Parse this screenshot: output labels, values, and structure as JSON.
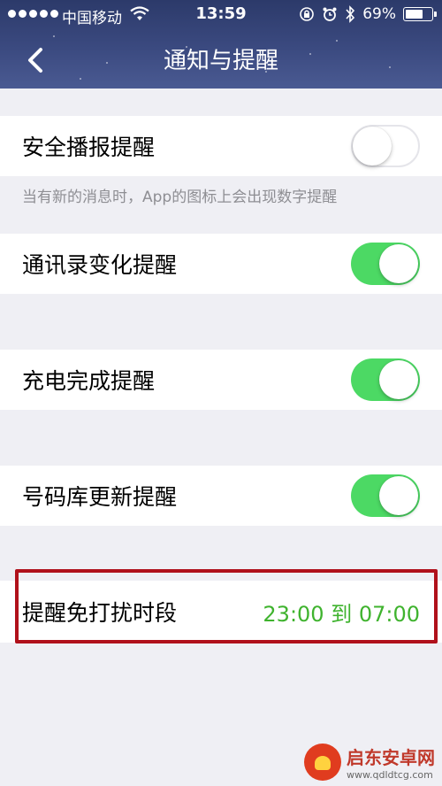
{
  "status_bar": {
    "carrier": "中国移动",
    "time": "13:59",
    "battery_percent": "69%",
    "battery_level": 0.69
  },
  "nav": {
    "title": "通知与提醒",
    "back_icon": "chevron-left-icon"
  },
  "settings": {
    "security_broadcast": {
      "label": "安全播报提醒",
      "enabled": false
    },
    "hint": "当有新的消息时，App的图标上会出现数字提醒",
    "contacts_change": {
      "label": "通讯录变化提醒",
      "enabled": true
    },
    "charge_complete": {
      "label": "充电完成提醒",
      "enabled": true
    },
    "number_db_update": {
      "label": "号码库更新提醒",
      "enabled": true
    },
    "dnd_period": {
      "label": "提醒免打扰时段",
      "value": "23:00 到 07:00"
    }
  },
  "watermark": {
    "name": "启东安卓网",
    "url": "www.qdldtcg.com"
  },
  "colors": {
    "switch_on": "#4cd964",
    "time_range": "#3fb32e",
    "highlight_border": "#b0111b",
    "header_bg": "#3b4a80"
  }
}
